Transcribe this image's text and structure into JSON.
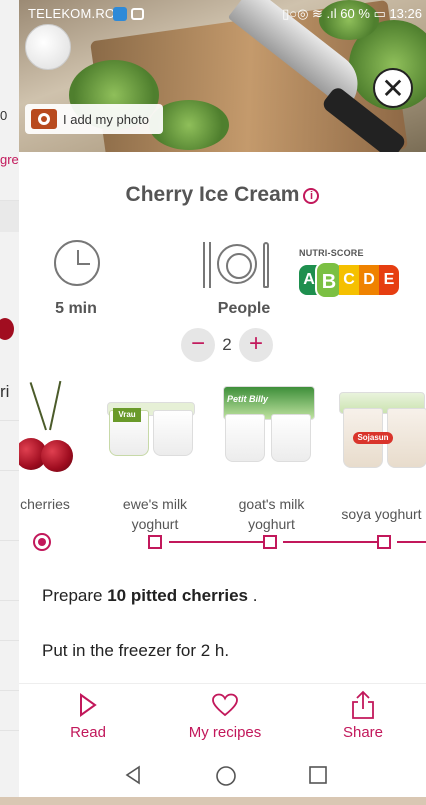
{
  "status_bar": {
    "carrier": "TELEKOM.RO",
    "battery": "60 %",
    "time": "13:26"
  },
  "header": {
    "add_photo_label": "I add my photo",
    "close_label": "✕"
  },
  "recipe": {
    "title": "Cherry Ice Cream",
    "info_label": "i",
    "time": "5 min",
    "people_label": "People",
    "servings": "2",
    "minus_label": "−",
    "plus_label": "+",
    "nutri_score": {
      "caption": "NUTRI-SCORE",
      "grades": [
        "A",
        "B",
        "C",
        "D",
        "E"
      ],
      "colors": [
        "#1e8f4e",
        "#7bc043",
        "#f5c000",
        "#ef8200",
        "#e63e11"
      ],
      "selected": "B"
    }
  },
  "ingredients": [
    {
      "name": "cherries"
    },
    {
      "name": "ewe's milk yoghurt",
      "line1": "ewe's milk",
      "line2": "yoghurt",
      "brand": "Vrau"
    },
    {
      "name": "goat's milk yoghurt",
      "line1": "goat's milk",
      "line2": "yoghurt",
      "brand": "Petit Billy"
    },
    {
      "name": "soya yoghurt",
      "line1": "soya yoghurt",
      "brand": "Sojasun"
    }
  ],
  "steps": [
    {
      "prefix": "Prepare ",
      "bold": "10 pitted cherries",
      "suffix": " ."
    },
    {
      "text": "Put in the freezer for 2 h."
    }
  ],
  "bottom_nav": [
    {
      "label": "Read",
      "icon": "play-icon"
    },
    {
      "label": "My recipes",
      "icon": "heart-icon"
    },
    {
      "label": "Share",
      "icon": "share-icon"
    }
  ],
  "background_page": {
    "texts": [
      "0",
      "gre",
      "ri"
    ]
  },
  "colors": {
    "accent": "#c2185b",
    "text_dark": "#222222",
    "text_muted": "#555555"
  }
}
